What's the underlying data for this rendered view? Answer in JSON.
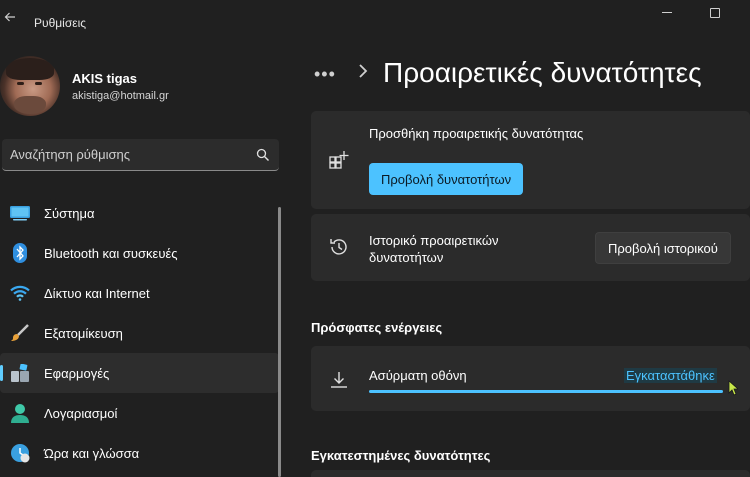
{
  "titlebar": {
    "app_title": "Ρυθμίσεις"
  },
  "profile": {
    "name": "AKIS tigas",
    "email": "akistiga@hotmail.gr"
  },
  "search": {
    "placeholder": "Αναζήτηση ρύθμισης"
  },
  "sidebar": {
    "items": [
      {
        "label": "Σύστημα",
        "icon": "system-icon"
      },
      {
        "label": "Bluetooth και συσκευές",
        "icon": "bluetooth-icon"
      },
      {
        "label": "Δίκτυο και Internet",
        "icon": "wifi-icon"
      },
      {
        "label": "Εξατομίκευση",
        "icon": "brush-icon"
      },
      {
        "label": "Εφαρμογές",
        "icon": "apps-icon",
        "selected": true
      },
      {
        "label": "Λογαριασμοί",
        "icon": "account-icon"
      },
      {
        "label": "Ώρα και γλώσσα",
        "icon": "time-language-icon"
      }
    ]
  },
  "header": {
    "breadcrumb_overflow": "•••",
    "title": "Προαιρετικές δυνατότητες"
  },
  "add_feature": {
    "label": "Προσθήκη προαιρετικής δυνατότητας",
    "button": "Προβολή δυνατοτήτων"
  },
  "history": {
    "label": "Ιστορικό προαιρετικών δυνατοτήτων",
    "button": "Προβολή ιστορικού"
  },
  "recent": {
    "heading": "Πρόσφατες ενέργειες",
    "item": {
      "name": "Ασύρματη οθόνη",
      "status": "Εγκαταστάθηκε",
      "progress": 1.0
    }
  },
  "installed": {
    "heading": "Εγκατεστημένες δυνατότητες"
  },
  "colors": {
    "accent": "#4cc2ff",
    "background": "#202020",
    "card": "#2b2b2b"
  }
}
